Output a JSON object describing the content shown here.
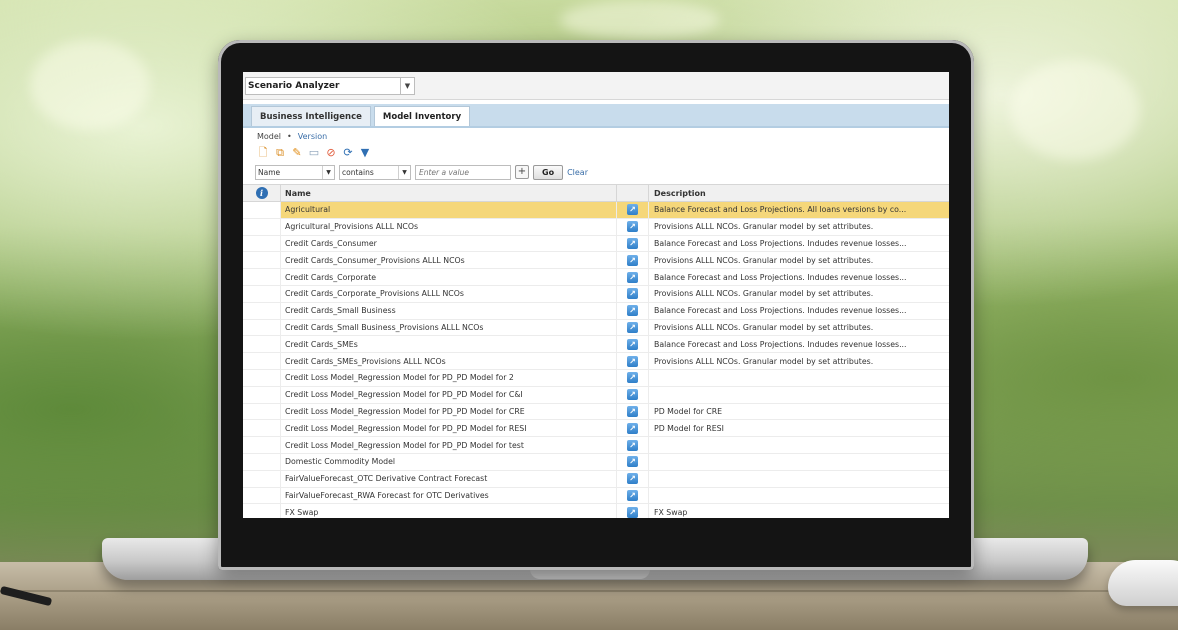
{
  "app": {
    "selector_label": "Scenario Analyzer"
  },
  "tabs": [
    {
      "label": "Business Intelligence",
      "active": false
    },
    {
      "label": "Model Inventory",
      "active": true
    }
  ],
  "breadcrumb": {
    "first": "Model",
    "second": "Version"
  },
  "filter": {
    "field": "Name",
    "operator": "contains",
    "value_placeholder": "Enter a value",
    "add_symbol": "+",
    "go_label": "Go",
    "clear_label": "Clear"
  },
  "toolbar_icons": [
    "new-icon",
    "copy-icon",
    "edit-icon",
    "save-icon",
    "cancel-icon",
    "refresh-icon",
    "filter-icon"
  ],
  "grid": {
    "headers": {
      "name": "Name",
      "description": "Description"
    },
    "rows": [
      {
        "name": "Agricultural",
        "description": "Balance Forecast and Loss Projections. All loans versions by co...",
        "selected": true
      },
      {
        "name": "Agricultural_Provisions ALLL NCOs",
        "description": "Provisions ALLL NCOs. Granular model by set attributes."
      },
      {
        "name": "Credit Cards_Consumer",
        "description": "Balance Forecast and Loss Projections. Indudes revenue losses..."
      },
      {
        "name": "Credit Cards_Consumer_Provisions ALLL NCOs",
        "description": "Provisions ALLL NCOs. Granular model by set attributes."
      },
      {
        "name": "Credit Cards_Corporate",
        "description": "Balance Forecast and Loss Projections. Indudes revenue losses..."
      },
      {
        "name": "Credit Cards_Corporate_Provisions ALLL NCOs",
        "description": "Provisions ALLL NCOs. Granular model by set attributes."
      },
      {
        "name": "Credit Cards_Small Business",
        "description": "Balance Forecast and Loss Projections. Indudes revenue losses..."
      },
      {
        "name": "Credit Cards_Small Business_Provisions ALLL NCOs",
        "description": "Provisions ALLL NCOs. Granular model by set attributes."
      },
      {
        "name": "Credit Cards_SMEs",
        "description": "Balance Forecast and Loss Projections. Indudes revenue losses..."
      },
      {
        "name": "Credit Cards_SMEs_Provisions ALLL NCOs",
        "description": "Provisions ALLL NCOs. Granular model by set attributes."
      },
      {
        "name": "Credit Loss Model_Regression Model for PD_PD Model for 2",
        "description": ""
      },
      {
        "name": "Credit Loss Model_Regression Model for PD_PD Model for C&I",
        "description": ""
      },
      {
        "name": "Credit Loss Model_Regression Model for PD_PD Model for CRE",
        "description": "PD Model for CRE"
      },
      {
        "name": "Credit Loss Model_Regression Model for PD_PD Model for RESI",
        "description": "PD Model for RESI"
      },
      {
        "name": "Credit Loss Model_Regression Model for PD_PD Model for test",
        "description": ""
      },
      {
        "name": "Domestic Commodity Model",
        "description": ""
      },
      {
        "name": "FairValueForecast_OTC Derivative Contract Forecast",
        "description": ""
      },
      {
        "name": "FairValueForecast_RWA Forecast for OTC Derivatives",
        "description": ""
      },
      {
        "name": "FX Swap",
        "description": "FX Swap"
      }
    ]
  },
  "colors": {
    "selected_row": "#f5d77a",
    "tab_bar": "#c8dcec",
    "link": "#3a6ea8",
    "icon_blue": "#2f7fc8"
  }
}
